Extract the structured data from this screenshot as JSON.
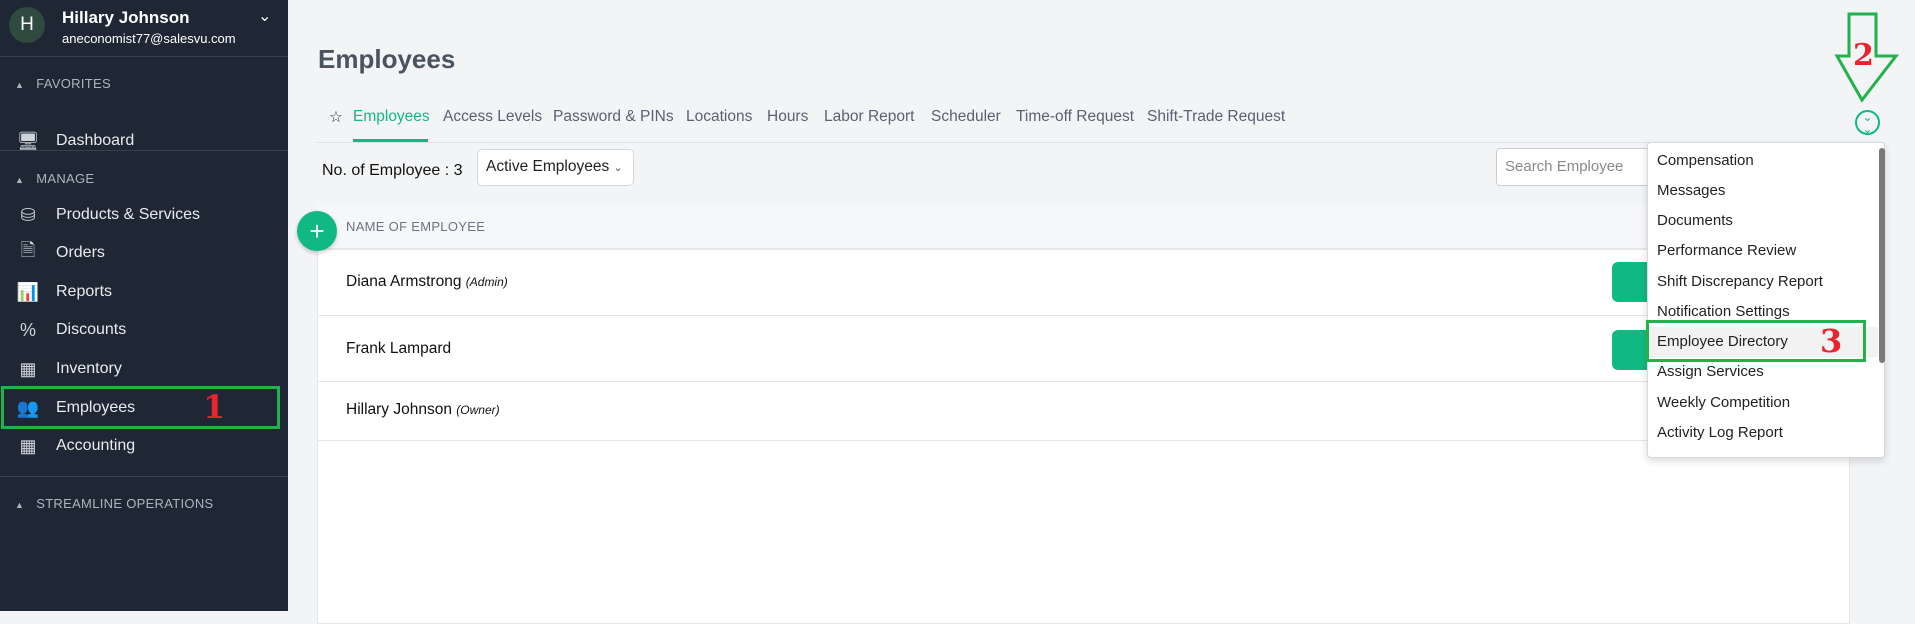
{
  "user": {
    "initial": "H",
    "name": "Hillary Johnson",
    "email": "aneconomist77@salesvu.com"
  },
  "sidebar": {
    "favorites_label": "FAVORITES",
    "favorites": [
      {
        "label": "Dashboard",
        "icon": "monitor-icon"
      }
    ],
    "manage_label": "MANAGE",
    "manage": [
      {
        "label": "Products & Services",
        "icon": "products-icon"
      },
      {
        "label": "Orders",
        "icon": "orders-icon"
      },
      {
        "label": "Reports",
        "icon": "reports-icon"
      },
      {
        "label": "Discounts",
        "icon": "discount-icon"
      },
      {
        "label": "Inventory",
        "icon": "inventory-icon"
      },
      {
        "label": "Employees",
        "icon": "employees-icon"
      },
      {
        "label": "Accounting",
        "icon": "calculator-icon"
      }
    ],
    "streamline_label": "STREAMLINE OPERATIONS"
  },
  "annotations": {
    "step1": "1",
    "step2": "2",
    "step3": "3",
    "highlight_color": "#22b14c",
    "number_color": "#e8242f"
  },
  "page": {
    "title": "Employees"
  },
  "tabs": [
    {
      "label": "Employees",
      "active": true
    },
    {
      "label": "Access Levels"
    },
    {
      "label": "Password & PINs"
    },
    {
      "label": "Locations"
    },
    {
      "label": "Hours"
    },
    {
      "label": "Labor Report"
    },
    {
      "label": "Scheduler"
    },
    {
      "label": "Time-off Request"
    },
    {
      "label": "Shift-Trade Request"
    }
  ],
  "toolbar": {
    "count_label": "No. of Employee : 3",
    "filter_value": "Active Employees",
    "search_placeholder": "Search Employee"
  },
  "table": {
    "header": "NAME OF EMPLOYEE",
    "rows": [
      {
        "name": "Diana Armstrong",
        "role": "(Admin)"
      },
      {
        "name": "Frank Lampard",
        "role": ""
      },
      {
        "name": "Hillary Johnson",
        "role": "(Owner)"
      }
    ]
  },
  "more_menu": {
    "items": [
      "Compensation",
      "Messages",
      "Documents",
      "Performance Review",
      "Shift Discrepancy Report",
      "Notification Settings",
      "Employee Directory",
      "Assign Services",
      "Weekly Competition",
      "Activity Log Report"
    ],
    "highlighted": "Employee Directory"
  },
  "colors": {
    "accent": "#10b981",
    "sidebar": "#1f2735"
  }
}
